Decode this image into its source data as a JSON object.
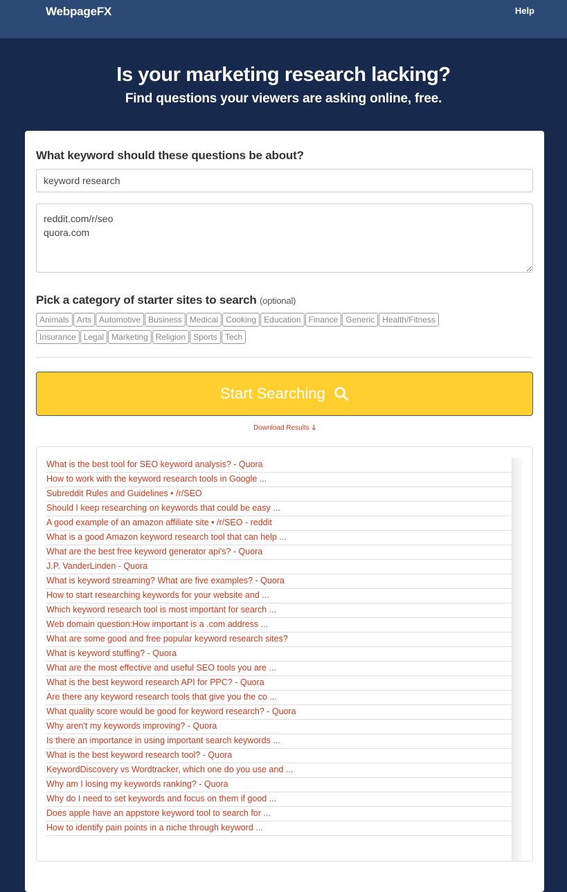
{
  "nav": {
    "brand": "WebpageFX",
    "help_label": "Help"
  },
  "hero": {
    "title": "Is your marketing research lacking?",
    "subtitle": "Find questions your viewers are asking online, free."
  },
  "form": {
    "keyword_label": "What keyword should these questions be about?",
    "keyword_value": "keyword research",
    "sites_value": "reddit.com/r/seo\nquora.com",
    "category_label": "Pick a category of starter sites to search",
    "category_optional": "(optional)",
    "categories": [
      "Animals",
      "Arts",
      "Automotive",
      "Business",
      "Medical",
      "Cooking",
      "Education",
      "Finance",
      "Generic",
      "Health/Fitness",
      "Insurance",
      "Legal",
      "Marketing",
      "Religion",
      "Sports",
      "Tech"
    ],
    "search_button_label": "Start Searching",
    "search_icon": "magnifier-icon",
    "download_label": "Download Results",
    "download_icon": "arrow-down-icon"
  },
  "colors": {
    "header_bg": "#2c4a76",
    "page_bg": "#172a4d",
    "button_bg": "#fecf2f",
    "link": "#d13a1c"
  },
  "results": [
    "What is the best tool for SEO keyword analysis? - Quora",
    "How to work with the keyword research tools in Google ...",
    "Subreddit Rules and Guidelines • /r/SEO",
    "Should I keep researching on keywords that could be easy ...",
    "A good example of an amazon affiliate site • /r/SEO - reddit",
    "What is a good Amazon keyword research tool that can help ...",
    "What are the best free keyword generator api's? - Quora",
    "J.P. VanderLinden - Quora",
    "What is keyword streaming? What are five examples? - Quora",
    "How to start researching keywords for your website and ...",
    "Which keyword research tool is most important for search ...",
    "Web domain question:How important is a .com address ...",
    "What are some good and free popular keyword research sites?",
    "What is keyword stuffing? - Quora",
    "What are the most effective and useful SEO tools you are ...",
    "What is the best keyword research API for PPC? - Quora",
    "Are there any keyword research tools that give you the co ...",
    "What quality score would be good for keyword research? - Quora",
    "Why aren't my keywords improving? - Quora",
    "Is there an importance in using important search keywords ...",
    "What is the best keyword research tool? - Quora",
    "KeywordDiscovery vs Wordtracker, which one do you use and ...",
    "Why am I losing my keywords ranking? - Quora",
    "Why do I need to set keywords and focus on them if good ...",
    "Does apple have an appstore keyword tool to search for ...",
    "How to identify pain points in a niche through keyword ..."
  ]
}
